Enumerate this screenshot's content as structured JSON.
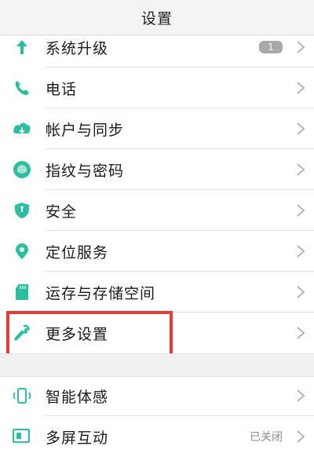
{
  "header": {
    "title": "设置"
  },
  "section1": [
    {
      "label": "系统升级",
      "icon": "arrow-up-icon",
      "badge": "1"
    },
    {
      "label": "电话",
      "icon": "phone-icon"
    },
    {
      "label": "帐户与同步",
      "icon": "cloud-sync-icon"
    },
    {
      "label": "指纹与密码",
      "icon": "fingerprint-icon"
    },
    {
      "label": "安全",
      "icon": "shield-icon"
    },
    {
      "label": "定位服务",
      "icon": "location-pin-icon"
    },
    {
      "label": "运存与存储空间",
      "icon": "sd-card-icon"
    },
    {
      "label": "更多设置",
      "icon": "wrench-icon"
    }
  ],
  "section2": [
    {
      "label": "智能体感",
      "icon": "phone-motion-icon"
    },
    {
      "label": "多屏互动",
      "icon": "multi-screen-icon",
      "status": "已关闭"
    }
  ],
  "colors": {
    "accent": "#2bbfa0",
    "highlight": "#e33a3a"
  }
}
